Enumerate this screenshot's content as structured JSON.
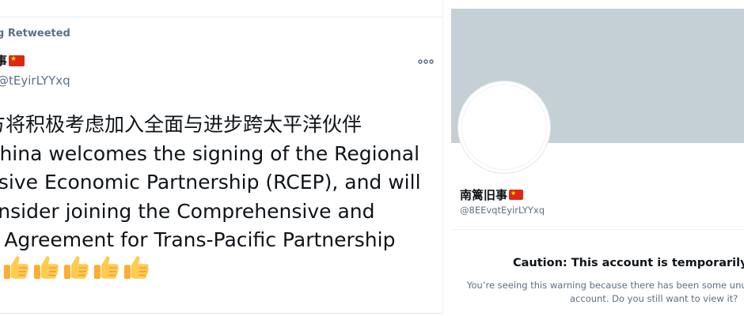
{
  "tweet": {
    "retweet_label": "g Retweeted",
    "author_name": "事",
    "author_handle": "@tEyirLYYxq",
    "body_lines": [
      "方将积极考虑加入全面与进步跨太平洋伙伴",
      " China welcomes the signing of the Regional",
      "nsive Economic Partnership (RCEP), and will",
      "onsider joining the Comprehensive and",
      "e Agreement for Trans-Pacific Partnership"
    ],
    "emoji": [
      "👍",
      "👍",
      "👍",
      "👍",
      "👍"
    ],
    "more_icon": "more-horizontal-icon",
    "flag_icon": "china-flag-icon"
  },
  "profile": {
    "name": "南篱旧事",
    "handle": "@8EEvqtEyirLYYxq",
    "flag_icon": "china-flag-icon",
    "caution_title": "Caution: This account is temporarily re",
    "caution_line1": "You’re seeing this warning because there has been some unus",
    "caution_line2": "account. Do you still want to view it?"
  },
  "colors": {
    "text_primary": "#0f1419",
    "text_secondary": "#5b7083",
    "banner": "#c4cfd6",
    "flag_red": "#de2910",
    "flag_star": "#ffde00",
    "divider": "#e6ecf0"
  }
}
